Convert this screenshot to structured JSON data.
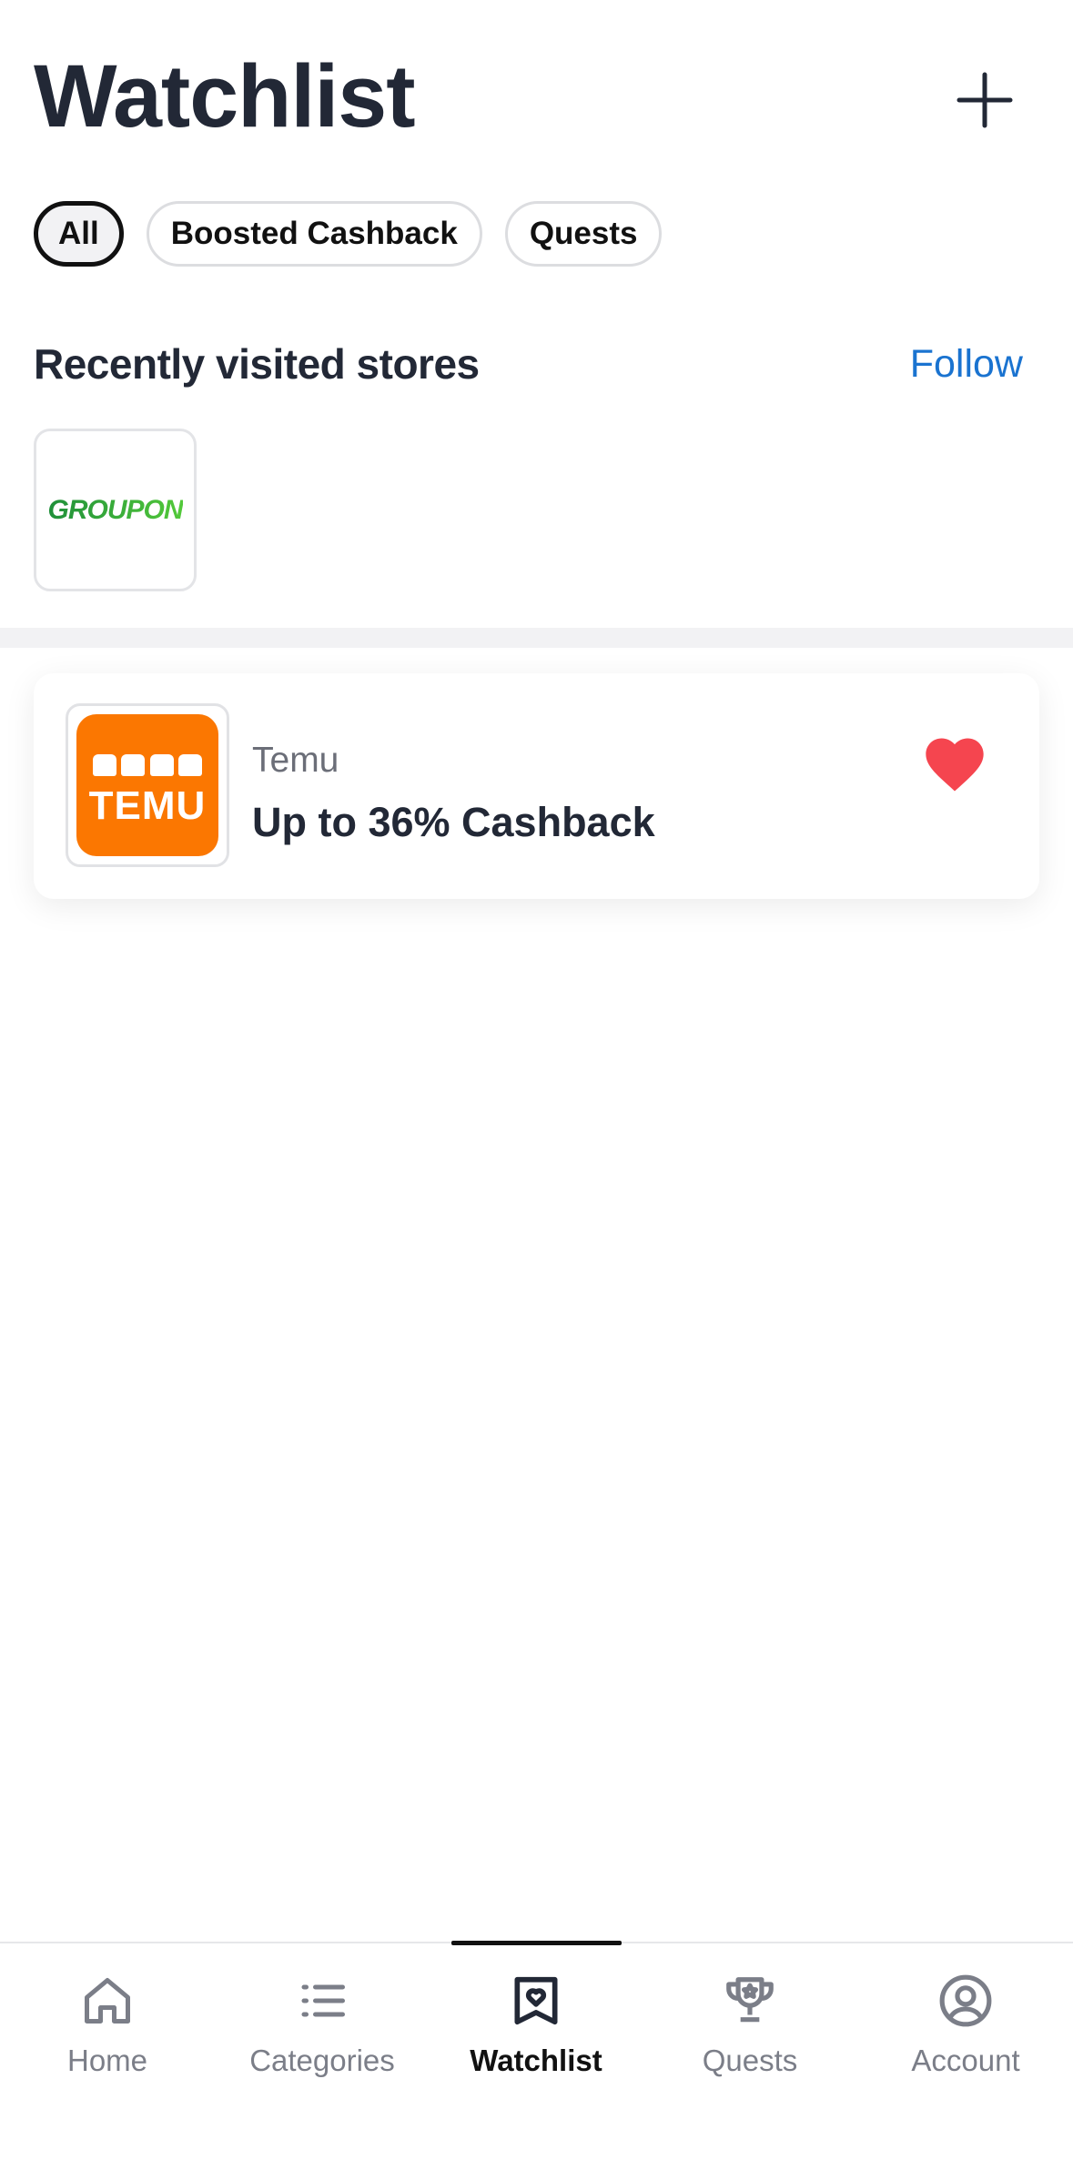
{
  "header": {
    "title": "Watchlist",
    "add_icon": "plus-icon"
  },
  "filters": [
    {
      "label": "All",
      "selected": true
    },
    {
      "label": "Boosted Cashback",
      "selected": false
    },
    {
      "label": "Quests",
      "selected": false
    }
  ],
  "recent": {
    "title": "Recently visited stores",
    "follow_label": "Follow",
    "stores": [
      {
        "logo_text": "GROUPON"
      }
    ]
  },
  "watchlist": {
    "items": [
      {
        "store": "Temu",
        "offer": "Up to 36% Cashback",
        "logo_text": "TEMU",
        "favorited": true,
        "heart_color": "#f5454f"
      }
    ]
  },
  "tabbar": {
    "tabs": [
      {
        "label": "Home",
        "icon": "home-icon",
        "active": false
      },
      {
        "label": "Categories",
        "icon": "list-icon",
        "active": false
      },
      {
        "label": "Watchlist",
        "icon": "bookmark-heart-icon",
        "active": true
      },
      {
        "label": "Quests",
        "icon": "trophy-icon",
        "active": false
      },
      {
        "label": "Account",
        "icon": "user-circle-icon",
        "active": false
      }
    ]
  },
  "colors": {
    "accent_link": "#1a73d0",
    "temu_orange": "#fb7701",
    "text_dark": "#222836"
  }
}
